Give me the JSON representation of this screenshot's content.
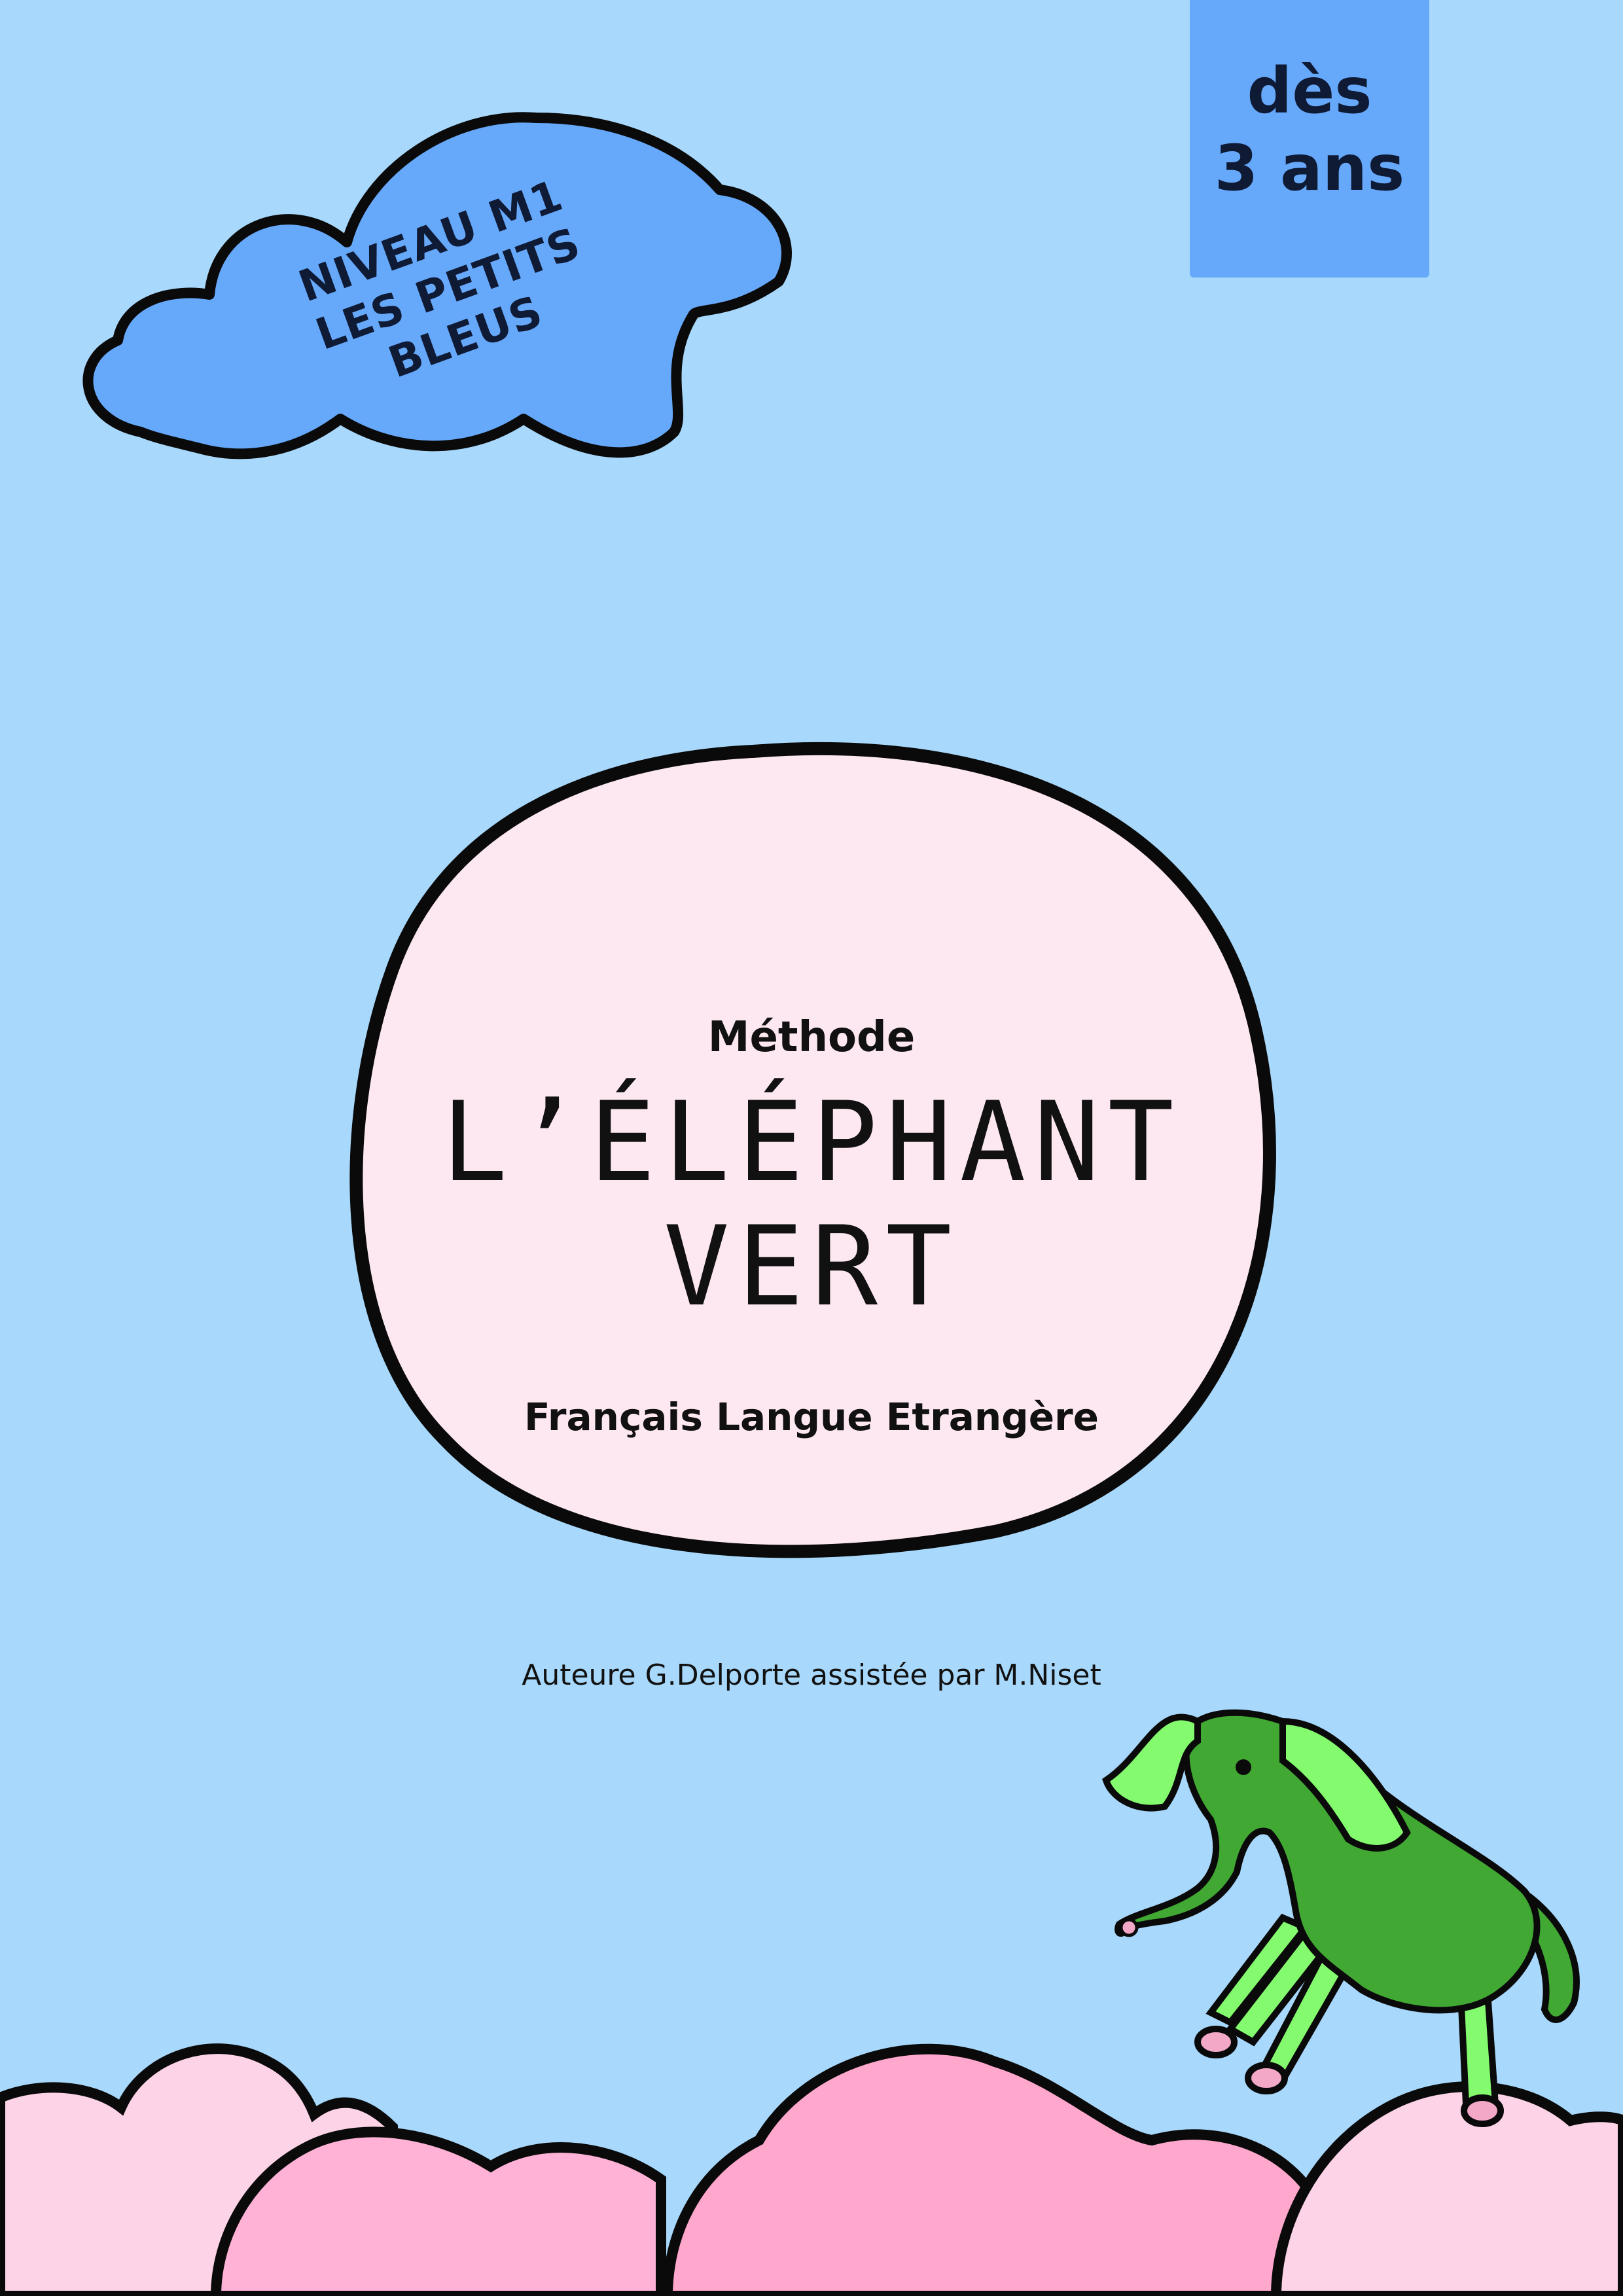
{
  "age_badge": {
    "line1": "dès",
    "line2": "3 ans"
  },
  "level_cloud": {
    "line1": "NIVEAU M1",
    "line2": "LES PETITS BLEUS"
  },
  "title_block": {
    "method": "Méthode",
    "title": "L’ÉLÉPHANT VERT",
    "subtitle": "Français Langue Etrangère"
  },
  "author": "Auteure G.Delporte assistée par M.Niset",
  "colors": {
    "background": "#a8d8fb",
    "blue_cloud": "#66a8fa",
    "oval": "#fde8f2",
    "pink_cloud_light": "#fdd3e8",
    "pink_cloud_mid": "#ffb2d6",
    "pink_cloud_dark": "#ffa7cd",
    "elephant_body": "#41a833",
    "elephant_ear": "#84fb6e"
  }
}
